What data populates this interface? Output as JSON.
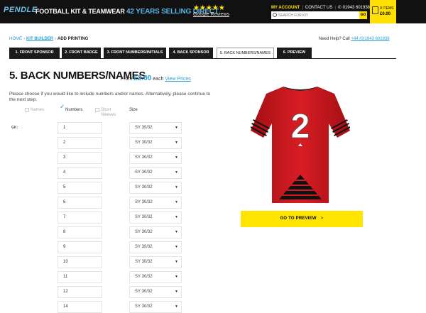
{
  "header": {
    "logo_text": "PENDLE",
    "tagline_a": "FOOTBALL KIT & TEAMWEAR",
    "tagline_b": "42 YEARS SELLING DIRECT",
    "stars": "★★★★★",
    "reviews_link": "Google Reviews",
    "my_account": "MY ACCOUNT",
    "contact": "CONTACT US",
    "phone": "01943 601938",
    "search_placeholder": "SEARCH FOR KIT",
    "go_label": "GO",
    "basket_items": "0 ITEMS",
    "basket_total": "£0.00"
  },
  "breadcrumb": {
    "home": "HOME",
    "kit_builder": "KIT BUILDER",
    "current": "ADD PRINTING"
  },
  "help": {
    "text": "Need Help? Call",
    "phone": "+44 (0)1943 601938"
  },
  "tabs": [
    {
      "label": "1. FRONT SPONSOR"
    },
    {
      "label": "2. FRONT BADGE"
    },
    {
      "label": "3. FRONT NUMBERS/INITIALS"
    },
    {
      "label": "4. BACK SPONSOR"
    },
    {
      "label": "5. BACK NUMBERS/NAMES"
    },
    {
      "label": "6. PREVIEW"
    }
  ],
  "step": {
    "heading": "5. BACK NUMBERS/NAMES",
    "from_text": "From",
    "price": "£2.00",
    "each": "each",
    "view_prices": "View Prices",
    "intro": "Please choose if you would like to include numbers and/or names. Alternatively, please continue to the next step."
  },
  "options": {
    "names": "Names",
    "numbers": "Numbers",
    "short_sleeves": "Short Sleeves",
    "size_header": "Size",
    "numbers_checked": true
  },
  "rows": [
    {
      "label": "GK:",
      "number": "1",
      "size": "SY 30/32"
    },
    {
      "label": "",
      "number": "2",
      "size": "SY 30/32"
    },
    {
      "label": "",
      "number": "3",
      "size": "SY 30/32"
    },
    {
      "label": "",
      "number": "4",
      "size": "SY 30/32"
    },
    {
      "label": "",
      "number": "5",
      "size": "SY 30/32"
    },
    {
      "label": "",
      "number": "6",
      "size": "SY 30/32"
    },
    {
      "label": "",
      "number": "7",
      "size": "SY 30/32"
    },
    {
      "label": "",
      "number": "8",
      "size": "SY 30/32"
    },
    {
      "label": "",
      "number": "9",
      "size": "SY 30/32"
    },
    {
      "label": "",
      "number": "10",
      "size": "SY 30/32"
    },
    {
      "label": "",
      "number": "11",
      "size": "SY 30/32"
    },
    {
      "label": "",
      "number": "12",
      "size": "SY 30/32"
    },
    {
      "label": "",
      "number": "14",
      "size": "SY 30/32"
    }
  ],
  "preview": {
    "shirt_number": "2",
    "button_label": "GO TO PREVIEW",
    "chevron": ">"
  },
  "colors": {
    "accent_yellow": "#ffe500",
    "link_blue": "#2a9fd6",
    "shirt_red": "#c8161d",
    "header_bg": "#111111"
  }
}
